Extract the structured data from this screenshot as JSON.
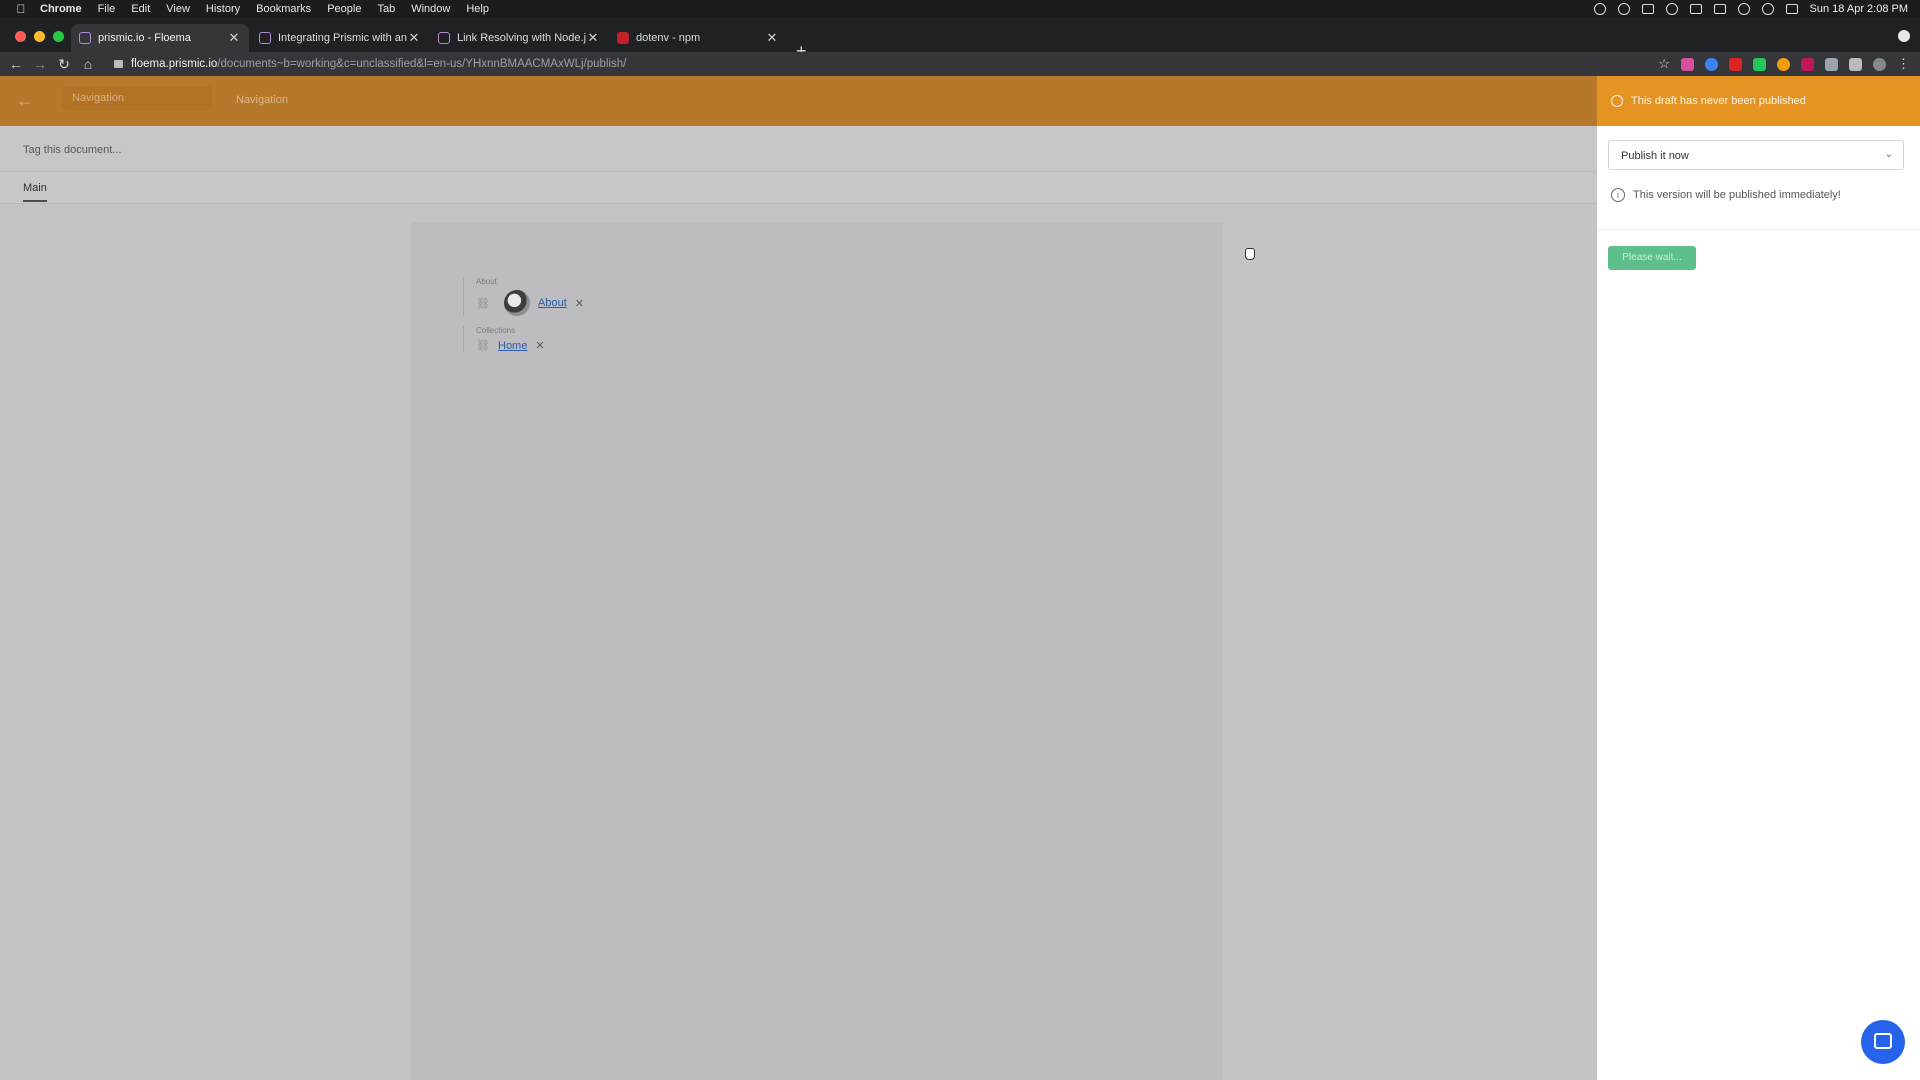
{
  "menubar": {
    "app": "Chrome",
    "items": [
      "File",
      "Edit",
      "View",
      "History",
      "Bookmarks",
      "People",
      "Tab",
      "Window",
      "Help"
    ],
    "clock": "Sun 18 Apr  2:08 PM"
  },
  "tabs": [
    {
      "title": "prismic.io - Floema",
      "active": true
    },
    {
      "title": "Integrating Prismic with an ex",
      "active": false
    },
    {
      "title": "Link Resolving with Node.js - P",
      "active": false
    },
    {
      "title": "dotenv - npm",
      "active": false
    }
  ],
  "omnibox": {
    "host": "floema.prismic.io",
    "path": "/documents~b=working&c=unclassified&l=en-us/YHxnnBMAACMAxWLj/publish/"
  },
  "header": {
    "nav_input": "Navigation",
    "nav_title": "Navigation"
  },
  "tag_placeholder": "Tag this document...",
  "doc_tab": "Main",
  "groups": [
    {
      "label": "About",
      "link": "About"
    },
    {
      "label": "Collections",
      "link": "Home"
    }
  ],
  "panel": {
    "status": "This draft has never been published",
    "select_value": "Publish it now",
    "info": "This version will be published immediately!",
    "button": "Please wait..."
  },
  "colors": {
    "accent_orange": "#e59322",
    "button_green": "#5fbf8a",
    "chat_blue": "#2563eb"
  }
}
